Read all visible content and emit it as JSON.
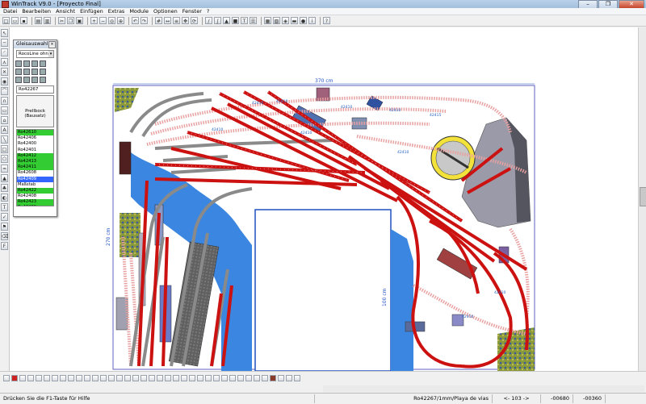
{
  "window": {
    "title": "WinTrack  V9.0 - [Proyecto Final]",
    "controls": [
      "–",
      "❐",
      "✕"
    ]
  },
  "menu": [
    "Datei",
    "Bearbeiten",
    "Ansicht",
    "Einfügen",
    "Extras",
    "Module",
    "Optionen",
    "Fenster",
    "?"
  ],
  "canvas": {
    "width_label": "370 cm",
    "height_label": "270 cm",
    "inner_height_label": "100 cm",
    "part_label": "42410",
    "part_label_b": "42415"
  },
  "panel": {
    "title": "Gleisauswahl",
    "system_select": "RocoLine ohne",
    "part_number": "Ro42267",
    "preview_name": "Prellbock",
    "preview_sub": "(Bausatz)",
    "items": [
      {
        "label": "Ro42610",
        "color": "green"
      },
      {
        "label": "Ro42406",
        "color": ""
      },
      {
        "label": "Ro42400",
        "color": ""
      },
      {
        "label": "Ro42401",
        "color": ""
      },
      {
        "label": "Ro42412",
        "color": "green"
      },
      {
        "label": "Ro42413",
        "color": "green"
      },
      {
        "label": "Ro42411",
        "color": "green"
      },
      {
        "label": "Ro42608",
        "color": ""
      },
      {
        "label": "Ro42409",
        "color": "blue"
      },
      {
        "label": "Maßstab",
        "color": ""
      },
      {
        "label": "Ro42422",
        "color": "green"
      },
      {
        "label": "Ro42408",
        "color": ""
      },
      {
        "label": "Ro42423",
        "color": "green"
      },
      {
        "label": "Ro42409",
        "color": "green"
      },
      {
        "label": "Ro42424",
        "color": "green"
      }
    ]
  },
  "status": {
    "hint": "Drücken Sie die  F1-Taste für Hilfe",
    "part": "Ro42267/1mm/Playa de vias",
    "zoom": "<- 103 ->",
    "x": "-00680",
    "y": "-00360"
  },
  "colors": {
    "track_red": "#cc1111",
    "water_blue": "#3a86e0",
    "grass": "#8a9a3a",
    "turntable_yellow": "#f2e23a",
    "shed_grey": "#9a9aa8"
  }
}
